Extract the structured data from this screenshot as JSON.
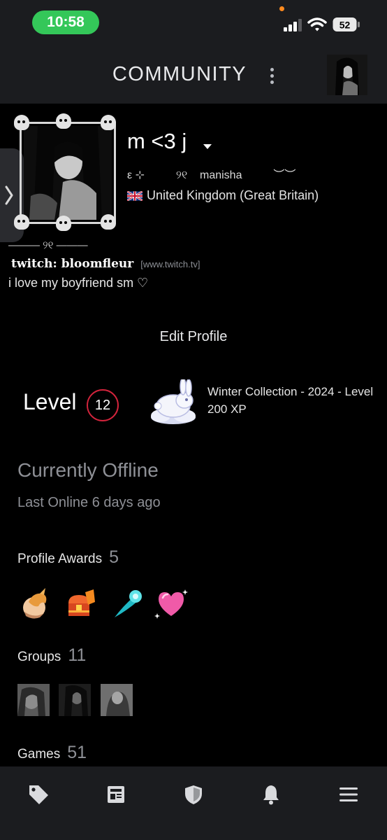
{
  "status_bar": {
    "time": "10:58",
    "battery": "52",
    "icons": [
      "signal-icon",
      "wifi-icon",
      "battery-icon"
    ],
    "time_pill_color": "#34c759"
  },
  "header": {
    "title": "COMMUNITY",
    "menu_icon": "kebab-menu-icon",
    "avatar": "user-avatar"
  },
  "side_tab": {
    "icon": "chevron-right-icon"
  },
  "profile": {
    "name": "m <3 j",
    "real_name_prefix": "ε ⊹",
    "real_name_mark": "୨୧",
    "real_name": "manisha",
    "real_name_suffix": "︶︶",
    "country": "United Kingdom (Great Britain)",
    "flag_icon": "uk-flag-icon",
    "divider": "——— ୨୧ ———",
    "twitch_label": "twitch: bloomfleur",
    "twitch_domain": "[www.twitch.tv]",
    "bio": "i love my boyfriend sm ♡",
    "edit_button": "Edit Profile"
  },
  "level": {
    "label": "Level",
    "value": "12",
    "ring_color": "#d3243c",
    "badge_icon": "bunny-badge-icon",
    "badge_title": "Winter Collection - 2024 - Level",
    "badge_xp": "200 XP"
  },
  "online_status": {
    "title": "Currently Offline",
    "subtitle": "Last Online 6 days ago"
  },
  "awards": {
    "label": "Profile Awards",
    "count": "5",
    "items": [
      "griffin-egg-icon",
      "treasure-chest-icon",
      "comet-icon",
      "sparkle-heart-icon"
    ]
  },
  "groups": {
    "label": "Groups",
    "count": "11",
    "items": [
      "group-avatar-1",
      "group-avatar-2",
      "group-avatar-3"
    ]
  },
  "games": {
    "label": "Games",
    "count": "51"
  },
  "bottom_nav": {
    "items": [
      "store-tag-icon",
      "news-icon",
      "guard-shield-icon",
      "notifications-bell-icon",
      "menu-icon"
    ]
  }
}
